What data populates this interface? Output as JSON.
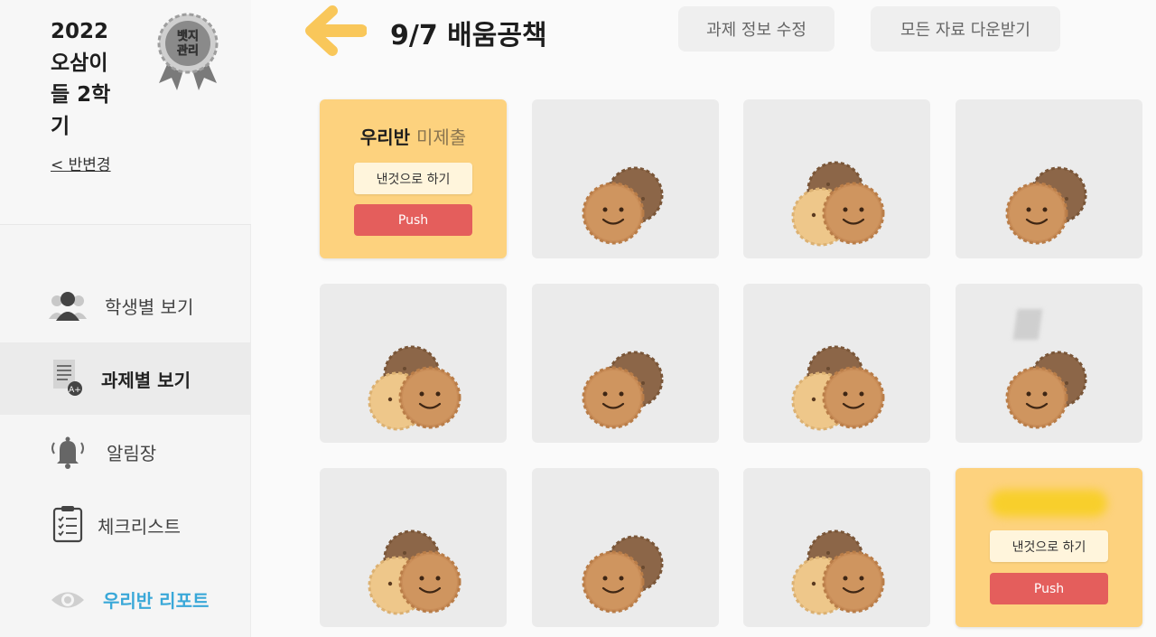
{
  "sidebar": {
    "class_title": "2022 오삼이들 2학기",
    "change_class": "< 반변경",
    "badge_text": "뱃지관리",
    "items": [
      {
        "label": "학생별 보기",
        "icon": "students-icon"
      },
      {
        "label": "과제별 보기",
        "icon": "assignment-icon"
      },
      {
        "label": "알림장",
        "icon": "bell-icon"
      },
      {
        "label": "체크리스트",
        "icon": "checklist-icon"
      },
      {
        "label": "우리반 리포트",
        "icon": "eye-icon"
      }
    ]
  },
  "header": {
    "title": "9/7 배움공책",
    "edit_button": "과제 정보 수정",
    "download_button": "모든 자료 다운받기"
  },
  "cards": {
    "first": {
      "title": "우리반",
      "subtitle": "미제출",
      "submit_label": "낸것으로 하기",
      "push_label": "Push"
    },
    "last": {
      "submit_label": "낸것으로 하기",
      "push_label": "Push"
    }
  },
  "colors": {
    "accent_yellow": "#fdd27e",
    "push_red": "#e45e5c",
    "report_blue": "#3aa8d8",
    "arrow_yellow": "#f9c75a"
  }
}
